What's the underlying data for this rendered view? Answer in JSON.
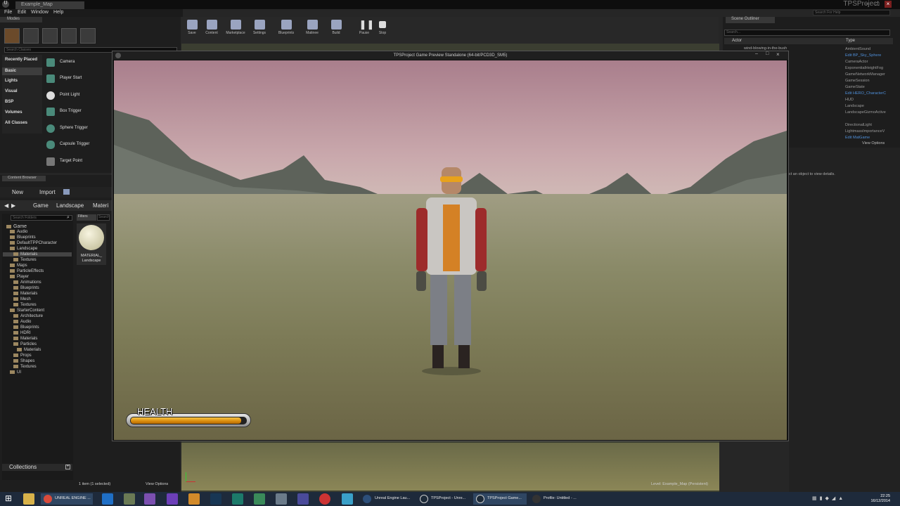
{
  "window": {
    "doc_tab": "Example_Map",
    "project": "TPSProject",
    "search_help": "Search For Help"
  },
  "menu": [
    "File",
    "Edit",
    "Window",
    "Help"
  ],
  "modes": {
    "tab": "Modes",
    "search_placeholder": "Search Classes",
    "categories": [
      "Recently Placed",
      "Basic",
      "Lights",
      "Visual",
      "BSP",
      "Volumes",
      "All Classes"
    ],
    "placeables": [
      "Camera",
      "Player Start",
      "Point Light",
      "Box Trigger",
      "Sphere Trigger",
      "Capsule Trigger",
      "Target Point"
    ]
  },
  "toolbar": [
    "Save",
    "Content",
    "Marketplace",
    "Settings",
    "Blueprints",
    "Matinee",
    "Build",
    "Pause",
    "Stop"
  ],
  "outliner": {
    "tab": "Scene Outliner",
    "search_placeholder": "Search...",
    "col_actor": "Actor",
    "col_type": "Type",
    "first_row": "wind-blowing-in-the-bush",
    "types": [
      "AmbientSound",
      "Edit BP_Sky_Sphere",
      "CameraActor",
      "ExponentialHeightFog",
      "GameNetworkManager",
      "GameSession",
      "GameState",
      "Edit HERO_CharacterC",
      "HUD",
      "Landscape",
      "LandscapeGizmoActive",
      "",
      "DirectionalLight",
      "LightmassImportanceV",
      "Edit MatGame"
    ],
    "view_options": "View Options",
    "details_hint": "ct an object to view details."
  },
  "content_browser": {
    "tab": "Content Browser",
    "new": "New",
    "import": "Import",
    "crumbs": [
      "Game",
      "Landscape",
      "Materi"
    ],
    "folder_search": "Search Folders",
    "filters": "Filters",
    "search_assets": "Search",
    "folders": [
      "Game",
      "Audio",
      "Blueprints",
      "DefaultTPPCharacter",
      "Landscape",
      "Materials",
      "Textures",
      "Maps",
      "ParticleEffects",
      "Player",
      "Animations",
      "Blueprints",
      "Materials",
      "Mesh",
      "Textures",
      "StarterContent",
      "Architecture",
      "Audio",
      "Blueprints",
      "HDRI",
      "Materials",
      "Particles",
      "Materials",
      "Props",
      "Shapes",
      "Textures",
      "UI"
    ],
    "asset_label_1": "MATERIAL_",
    "asset_label_2": "Landscape",
    "collections": "Collections",
    "status": "1 item (1 selected)",
    "view_options": "View Options"
  },
  "game_window": {
    "title": "TPSProject Game Preview Standalone (64-bit/PCD3D_SM5)",
    "health_label": "HEALTH",
    "health_fraction": 0.96
  },
  "viewport": {
    "level_info": "Level:  Example_Map (Persistent)"
  },
  "taskbar": {
    "items": [
      "UNREAL ENGINE ...",
      "Unreal Engine Lau...",
      "TPSProject - Unre...",
      "TPSProject Game...",
      "Profile: Untitled - ..."
    ],
    "time": "22:25",
    "date": "16/12/2014"
  },
  "colors": {
    "accent": "#4f8fd9",
    "health": "#e8a21c"
  }
}
